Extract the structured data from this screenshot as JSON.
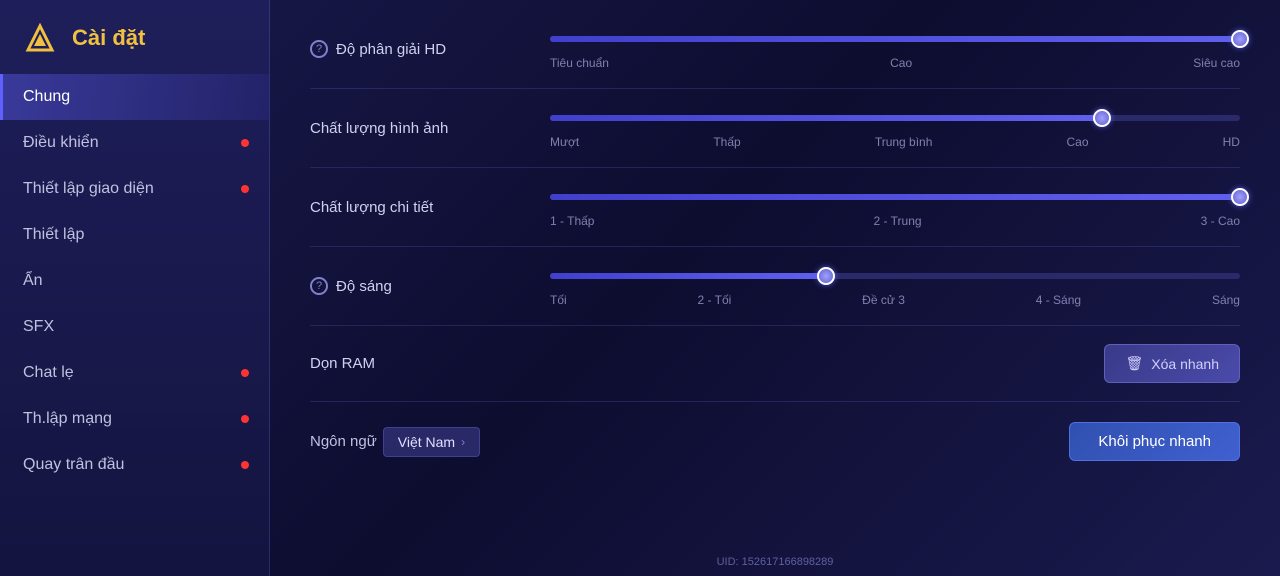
{
  "logo": {
    "title": "Cài đặt"
  },
  "sidebar": {
    "items": [
      {
        "id": "chung",
        "label": "Chung",
        "active": true,
        "dot": false
      },
      {
        "id": "dieu-khien",
        "label": "Điều khiển",
        "active": false,
        "dot": true
      },
      {
        "id": "thiet-lap-giao-dien",
        "label": "Thiết lập giao diện",
        "active": false,
        "dot": true
      },
      {
        "id": "thiet-lap",
        "label": "Thiết lập",
        "active": false,
        "dot": false
      },
      {
        "id": "an",
        "label": "Ẩn",
        "active": false,
        "dot": false
      },
      {
        "id": "sfx",
        "label": "SFX",
        "active": false,
        "dot": false
      },
      {
        "id": "chat-le",
        "label": "Chat lẹ",
        "active": false,
        "dot": true
      },
      {
        "id": "thlap-mang",
        "label": "Th.lập mạng",
        "active": false,
        "dot": true
      },
      {
        "id": "quay-tran-dau",
        "label": "Quay trân đầu",
        "active": false,
        "dot": true
      }
    ]
  },
  "settings": {
    "hd_resolution": {
      "label": "Độ phân giải HD",
      "has_help": true,
      "fill_pct": 100,
      "thumb_pct": 100,
      "labels": [
        "Tiêu chuẩn",
        "Cao",
        "Siêu cao"
      ]
    },
    "image_quality": {
      "label": "Chất lượng hình ảnh",
      "has_help": false,
      "fill_pct": 80,
      "thumb_pct": 80,
      "labels": [
        "Mượt",
        "Thấp",
        "Trung bình",
        "Cao",
        "HD"
      ]
    },
    "detail_quality": {
      "label": "Chất lượng chi tiết",
      "has_help": false,
      "fill_pct": 100,
      "thumb_pct": 100,
      "labels": [
        "1 - Thấp",
        "2 - Trung",
        "3 - Cao"
      ]
    },
    "brightness": {
      "label": "Độ sáng",
      "has_help": true,
      "fill_pct": 40,
      "thumb_pct": 40,
      "labels": [
        "Tối",
        "2 - Tối",
        "Đề cử 3",
        "4 - Sáng",
        "Sáng"
      ]
    },
    "clean_ram": {
      "label": "Dọn RAM",
      "button_label": "Xóa nhanh"
    }
  },
  "bottom": {
    "language_label": "Ngôn ngữ",
    "language_value": "Việt Nam",
    "restore_label": "Khôi phục nhanh"
  },
  "uid": "UID: 152617166898289"
}
